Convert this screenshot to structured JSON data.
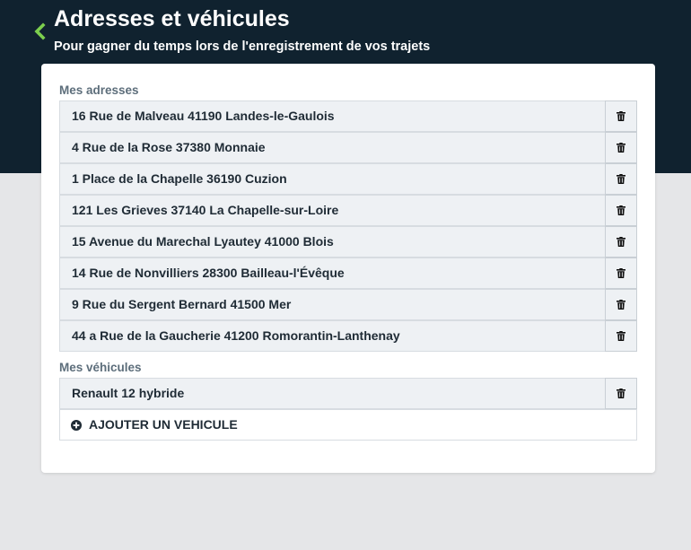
{
  "header": {
    "title": "Adresses et véhicules",
    "subtitle": "Pour gagner du temps lors de l'enregistrement de vos trajets",
    "back_icon": "chevron-left-icon",
    "accent_color": "#7ccf4e",
    "background_color": "#10222f"
  },
  "addresses": {
    "label": "Mes adresses",
    "items": [
      "16 Rue de Malveau 41190 Landes-le-Gaulois",
      "4 Rue de la Rose 37380 Monnaie",
      "1 Place de la Chapelle 36190 Cuzion",
      "121 Les Grieves 37140 La Chapelle-sur-Loire",
      "15 Avenue du Marechal Lyautey 41000 Blois",
      "14 Rue de Nonvilliers 28300 Bailleau-l'Évêque",
      "9 Rue du Sergent Bernard 41500 Mer",
      "44 a Rue de la Gaucherie 41200 Romorantin-Lanthenay"
    ]
  },
  "vehicles": {
    "label": "Mes véhicules",
    "items": [
      "Renault 12 hybride"
    ],
    "add_label": "AJOUTER UN VEHICULE",
    "add_icon": "plus-circle-icon"
  },
  "delete_icon": "trash-icon"
}
